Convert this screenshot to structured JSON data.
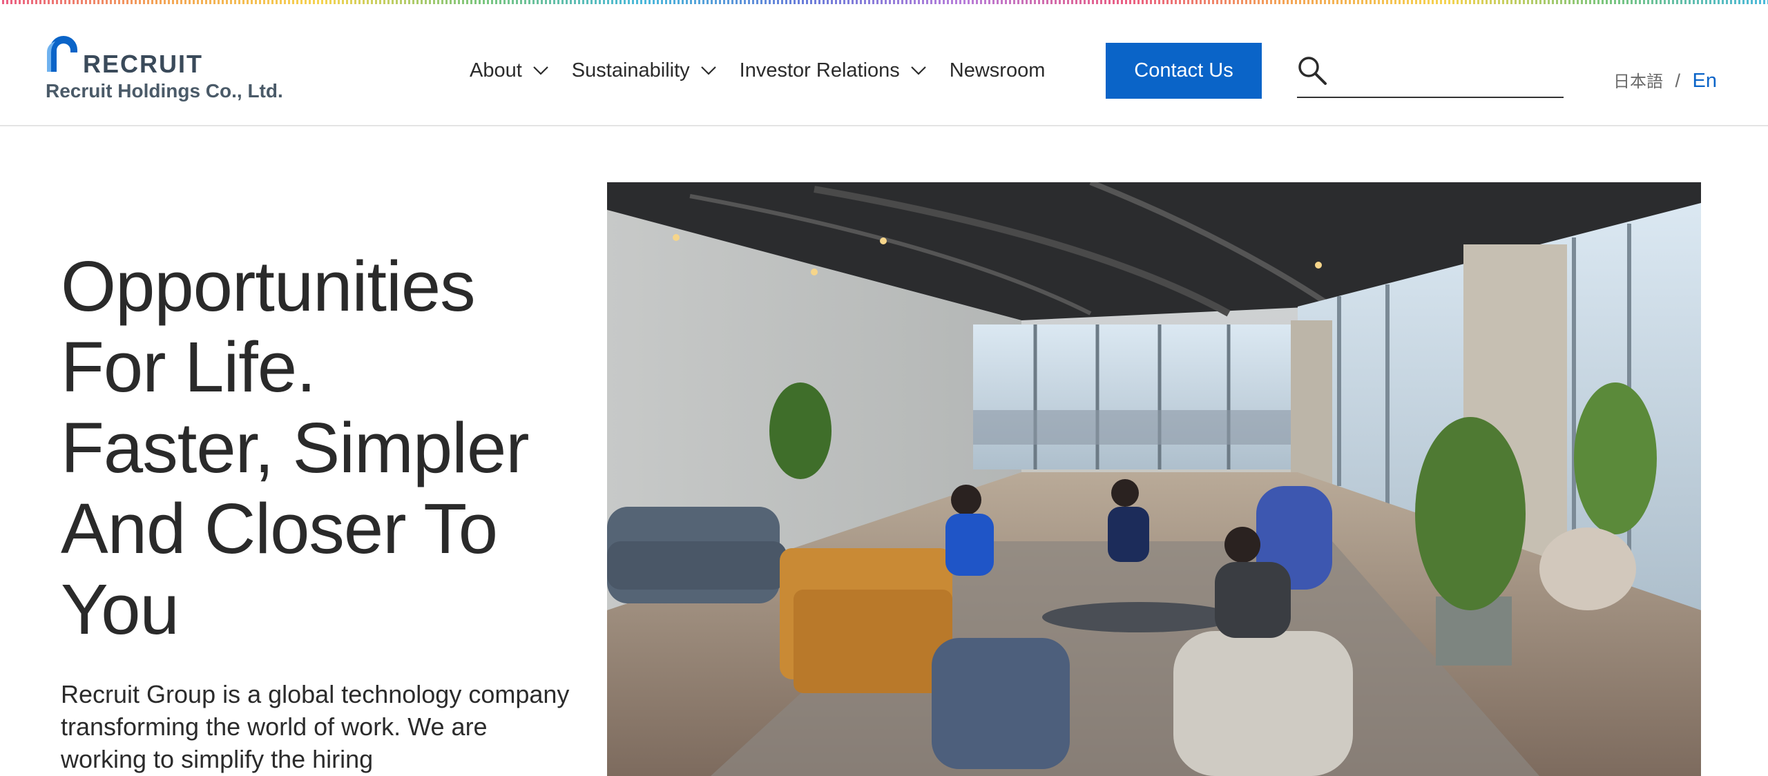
{
  "brand": {
    "wordmark": "RECRUIT",
    "company_name": "Recruit Holdings Co., Ltd.",
    "logo_color": "#0a64c8"
  },
  "nav": {
    "items": [
      {
        "label": "About",
        "has_dropdown": true
      },
      {
        "label": "Sustainability",
        "has_dropdown": true
      },
      {
        "label": "Investor Relations",
        "has_dropdown": true
      },
      {
        "label": "Newsroom",
        "has_dropdown": false
      }
    ],
    "contact_label": "Contact Us",
    "contact_color": "#0a64c8"
  },
  "search": {
    "icon": "search-icon",
    "value": "",
    "placeholder": ""
  },
  "language": {
    "japanese": "日本語",
    "separator": "/",
    "english": "En",
    "active": "En"
  },
  "hero": {
    "title_lines": [
      "Opportunities",
      "For Life.",
      "Faster, Simpler",
      "And Closer To",
      "You"
    ],
    "description": "Recruit Group is a global technology company transforming the world of work. We are working to simplify the hiring",
    "image_alt": "Open office lounge with people working, large windows overlooking a city"
  }
}
